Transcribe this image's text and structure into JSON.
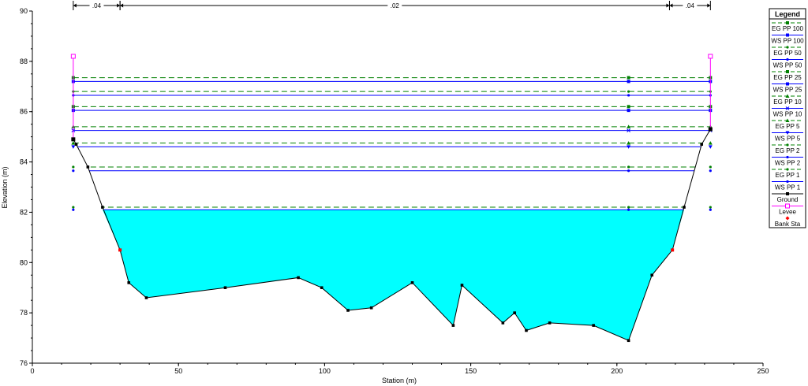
{
  "chart_data": {
    "type": "line",
    "xlabel": "Station (m)",
    "ylabel": "Elevation (m)",
    "xlim": [
      0,
      250
    ],
    "ylim": [
      76,
      90
    ],
    "x_ticks": [
      0,
      50,
      100,
      150,
      200,
      250
    ],
    "y_ticks": [
      76,
      78,
      80,
      82,
      84,
      86,
      88,
      90
    ],
    "grid": false,
    "legend_position": "right",
    "legend_title": "Legend",
    "manning_n": [
      {
        "label": ".04",
        "from": 14,
        "to": 30
      },
      {
        "label": ".02",
        "from": 30,
        "to": 218
      },
      {
        "label": ".04",
        "from": 218,
        "to": 232
      }
    ],
    "ground": {
      "name": "Ground",
      "color": "#000000",
      "points": [
        [
          14,
          84.9
        ],
        [
          15,
          84.7
        ],
        [
          19,
          83.8
        ],
        [
          24,
          82.2
        ],
        [
          30,
          80.5
        ],
        [
          33,
          79.2
        ],
        [
          39,
          78.6
        ],
        [
          66,
          79.0
        ],
        [
          91,
          79.4
        ],
        [
          99,
          79.0
        ],
        [
          108,
          78.1
        ],
        [
          116,
          78.2
        ],
        [
          130,
          79.2
        ],
        [
          144,
          77.5
        ],
        [
          147,
          79.1
        ],
        [
          161,
          77.6
        ],
        [
          165,
          78.0
        ],
        [
          169,
          77.3
        ],
        [
          177,
          77.6
        ],
        [
          192,
          77.5
        ],
        [
          204,
          76.9
        ],
        [
          212,
          79.5
        ],
        [
          219,
          80.5
        ],
        [
          223,
          82.2
        ],
        [
          229,
          84.7
        ],
        [
          232,
          85.3
        ]
      ]
    },
    "water_fill": {
      "elevation": 82.1,
      "color": "#00FFFF"
    },
    "profiles": [
      {
        "name": "EG PP 100",
        "kind": "EG",
        "elevation": 87.35,
        "color": "#008000",
        "marker": "square"
      },
      {
        "name": "WS PP 100",
        "kind": "WS",
        "elevation": 87.2,
        "color": "#0000FF",
        "marker": "square"
      },
      {
        "name": "EG PP 50",
        "kind": "EG",
        "elevation": 86.8,
        "color": "#008000",
        "marker": "dot"
      },
      {
        "name": "WS PP 50",
        "kind": "WS",
        "elevation": 86.65,
        "color": "#0000FF",
        "marker": "dot"
      },
      {
        "name": "EG PP 25",
        "kind": "EG",
        "elevation": 86.2,
        "color": "#008000",
        "marker": "square"
      },
      {
        "name": "WS PP 25",
        "kind": "WS",
        "elevation": 86.05,
        "color": "#0000FF",
        "marker": "square"
      },
      {
        "name": "EG PP 10",
        "kind": "EG",
        "elevation": 85.4,
        "color": "#008000",
        "marker": "triangle"
      },
      {
        "name": "WS PP 10",
        "kind": "WS",
        "elevation": 85.25,
        "color": "#0000FF",
        "marker": "x"
      },
      {
        "name": "EG PP 5",
        "kind": "EG",
        "elevation": 84.75,
        "color": "#008000",
        "marker": "triangle"
      },
      {
        "name": "WS PP 5",
        "kind": "WS",
        "elevation": 84.6,
        "color": "#0000FF",
        "marker": "triangle-down"
      },
      {
        "name": "EG PP 2",
        "kind": "EG",
        "elevation": 83.8,
        "color": "#008000",
        "marker": "dot"
      },
      {
        "name": "WS PP 2",
        "kind": "WS",
        "elevation": 83.65,
        "color": "#0000FF",
        "marker": "dot"
      },
      {
        "name": "EG PP 1",
        "kind": "EG",
        "elevation": 82.2,
        "color": "#008000",
        "marker": "dot"
      },
      {
        "name": "WS PP 1",
        "kind": "WS",
        "elevation": 82.1,
        "color": "#0000FF",
        "marker": "dot"
      }
    ],
    "levees": {
      "name": "Levee",
      "color": "#FF00FF",
      "points": [
        [
          14,
          88.2
        ],
        [
          232,
          88.2
        ]
      ],
      "bottoms": [
        84.9,
        85.3
      ]
    },
    "bank_stations": {
      "name": "Bank Sta",
      "color": "#FF0000",
      "points": [
        [
          30,
          80.5
        ],
        [
          219,
          80.5
        ]
      ]
    },
    "legend_entries": [
      "EG PP 100",
      "WS PP 100",
      "EG PP 50",
      "WS PP 50",
      "EG PP 25",
      "WS PP 25",
      "EG PP 10",
      "WS PP 10",
      "EG PP 5",
      "WS PP 5",
      "EG PP 2",
      "WS PP 2",
      "EG PP 1",
      "WS PP 1",
      "Ground",
      "Levee",
      "Bank Sta"
    ]
  }
}
